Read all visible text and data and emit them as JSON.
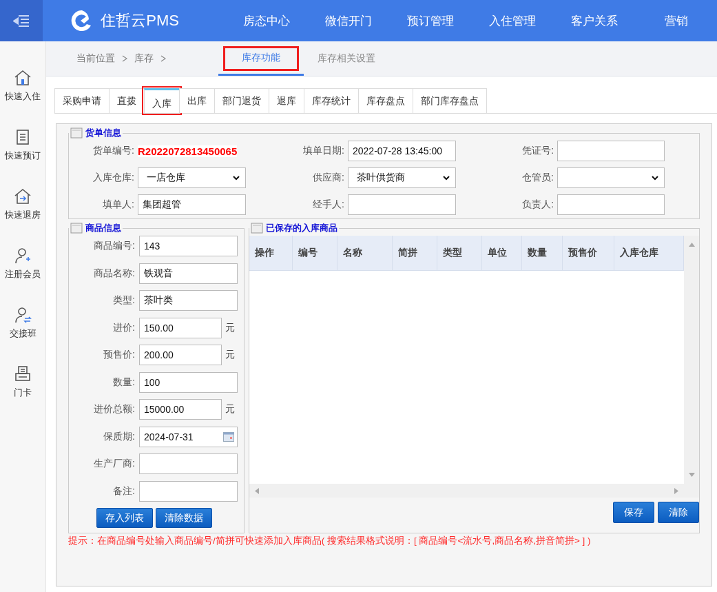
{
  "header": {
    "brand": "住哲云PMS",
    "nav": [
      {
        "label": "房态中心"
      },
      {
        "label": "微信开门"
      },
      {
        "label": "预订管理"
      },
      {
        "label": "入住管理"
      },
      {
        "label": "客户关系"
      },
      {
        "label": "营销"
      }
    ]
  },
  "sidebar": {
    "items": [
      {
        "label": "快速入住",
        "kind": "checkin"
      },
      {
        "label": "快速预订",
        "kind": "booking"
      },
      {
        "label": "快速退房",
        "kind": "checkout"
      },
      {
        "label": "注册会员",
        "kind": "register"
      },
      {
        "label": "交接班",
        "kind": "handover"
      },
      {
        "label": "门卡",
        "kind": "doorcard"
      }
    ]
  },
  "breadcrumb": {
    "items": [
      "当前位置",
      "库存"
    ],
    "tabs": [
      {
        "label": "库存功能",
        "selected": true
      },
      {
        "label": "库存相关设置",
        "selected": false
      }
    ]
  },
  "tabs": [
    {
      "label": "采购申请",
      "selected": false
    },
    {
      "label": "直拨",
      "selected": false
    },
    {
      "label": "入库",
      "selected": true
    },
    {
      "label": "出库",
      "selected": false
    },
    {
      "label": "部门退货",
      "selected": false
    },
    {
      "label": "退库",
      "selected": false
    },
    {
      "label": "库存统计",
      "selected": false
    },
    {
      "label": "库存盘点",
      "selected": false
    },
    {
      "label": "部门库存盘点",
      "selected": false
    }
  ],
  "order_info": {
    "title": "货单信息",
    "fields": [
      {
        "label": "货单编号:",
        "kind": "code",
        "value": "R2022072813450065"
      },
      {
        "label": "填单日期:",
        "kind": "input",
        "value": "2022-07-28 13:45:00"
      },
      {
        "label": "凭证号:",
        "kind": "input"
      },
      {
        "label": "入库仓库:",
        "kind": "select",
        "value": "一店仓库"
      },
      {
        "label": "供应商:",
        "kind": "select",
        "value": "茶叶供货商"
      },
      {
        "label": "仓管员:",
        "kind": "select"
      },
      {
        "label": "填单人:",
        "kind": "input",
        "value": "集团超管"
      },
      {
        "label": "经手人:",
        "kind": "input"
      },
      {
        "label": "负责人:",
        "kind": "input"
      }
    ]
  },
  "goods_info": {
    "title": "商品信息",
    "fields": [
      {
        "label": "商品编号:",
        "kind": "input",
        "value": "143"
      },
      {
        "label": "商品名称:",
        "kind": "input",
        "value": "铁观音"
      },
      {
        "label": "类型:",
        "kind": "input",
        "value": "茶叶类"
      },
      {
        "label": "进价:",
        "kind": "input",
        "value": "150.00",
        "unit": "元"
      },
      {
        "label": "预售价:",
        "kind": "input",
        "value": "200.00",
        "unit": "元"
      },
      {
        "label": "数量:",
        "kind": "input",
        "value": "100"
      },
      {
        "label": "进价总额:",
        "kind": "input",
        "value": "15000.00",
        "unit": "元"
      },
      {
        "label": "保质期:",
        "kind": "date",
        "value": "2024-07-31"
      },
      {
        "label": "生产厂商:",
        "kind": "input"
      },
      {
        "label": "备注:",
        "kind": "input"
      }
    ],
    "buttons": [
      "存入列表",
      "清除数据"
    ]
  },
  "saved_goods": {
    "title": "已保存的入库商品",
    "columns": [
      "操作",
      "编号",
      "名称",
      "简拼",
      "类型",
      "单位",
      "数量",
      "预售价",
      "入库仓库"
    ],
    "buttons": [
      "保存",
      "清除"
    ]
  },
  "hint": "提示：在商品编号处输入商品编号/简拼可快速添加入库商品( 搜索结果格式说明：[ 商品编号<流水号,商品名称,拼音简拼> ] )"
}
